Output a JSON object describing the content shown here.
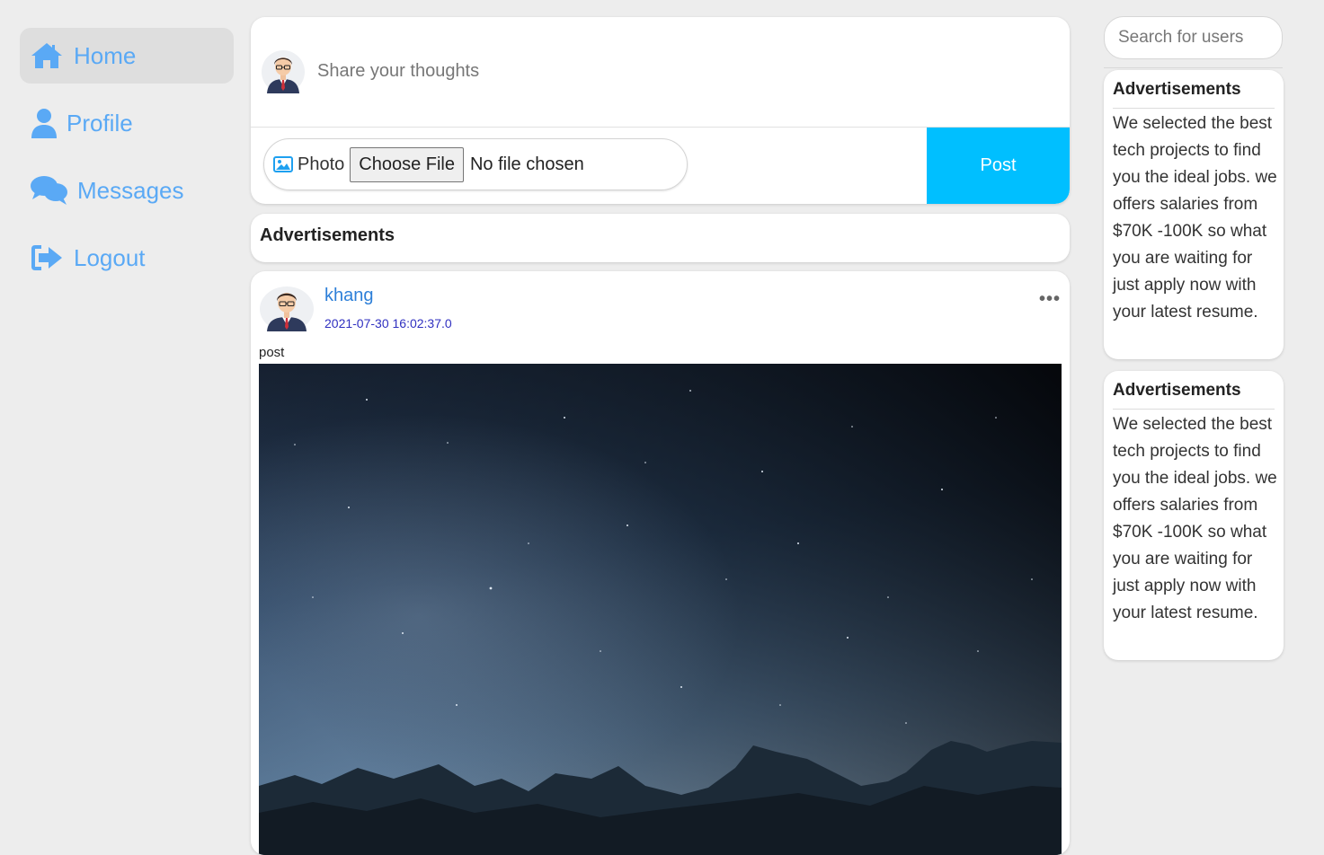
{
  "sidebar": {
    "items": [
      {
        "label": "Home",
        "icon": "home-icon",
        "active": true
      },
      {
        "label": "Profile",
        "icon": "user-icon",
        "active": false
      },
      {
        "label": "Messages",
        "icon": "messages-icon",
        "active": false
      },
      {
        "label": "Logout",
        "icon": "logout-icon",
        "active": false
      }
    ],
    "accent_color": "#5aa9f5"
  },
  "composer": {
    "placeholder": "Share your thoughts",
    "photo_label": "Photo",
    "choose_file_label": "Choose File",
    "no_file_text": "No file chosen",
    "post_label": "Post",
    "post_color": "#00bfff"
  },
  "ads_bar": {
    "title": "Advertisements"
  },
  "post": {
    "author": "khang",
    "timestamp": "2021-07-30 16:02:37.0",
    "more_label": "•••",
    "text": "post",
    "image_subject": "night-sky-mountains"
  },
  "right": {
    "search_placeholder": "Search for users",
    "ads": [
      {
        "title": "Advertisements",
        "body": "We selected the best tech projects to find you the ideal jobs. we offers salaries from $70K -100K so what you are waiting for just apply now with your latest resume."
      },
      {
        "title": "Advertisements",
        "body": "We selected the best tech projects to find you the ideal jobs. we offers salaries from $70K -100K so what you are waiting for just apply now with your latest resume."
      }
    ]
  }
}
